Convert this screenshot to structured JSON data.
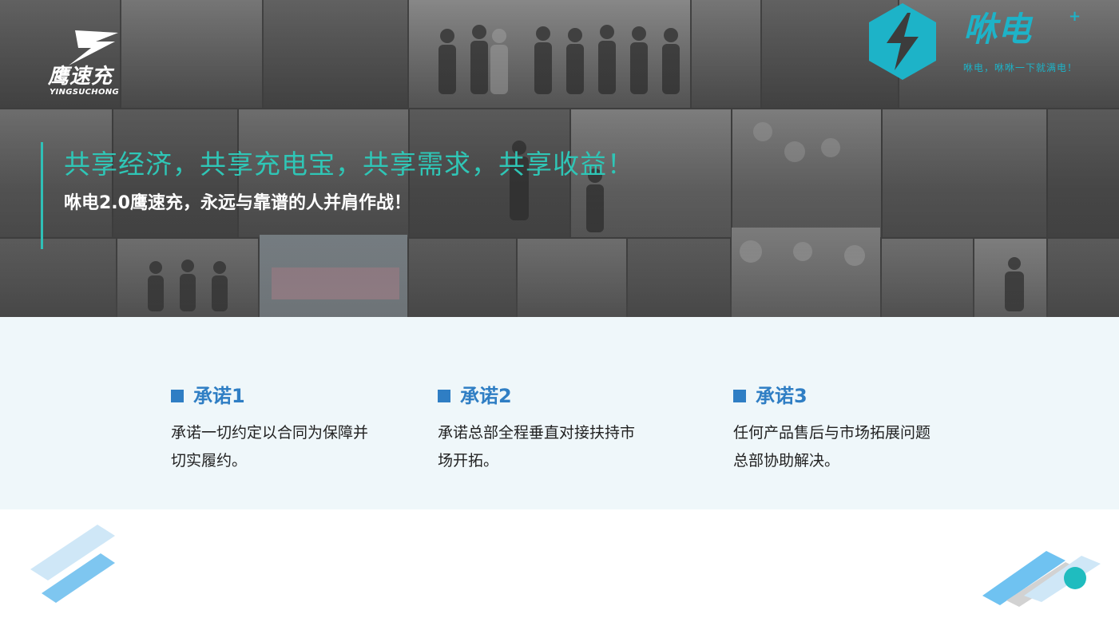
{
  "hero": {
    "brand_left": {
      "name": "鹰速充",
      "pinyin": "YINGSUCHONG"
    },
    "brand_right": {
      "name": "咻电",
      "plus": "+",
      "tagline": "咻电，咻咻一下就满电！"
    },
    "title": "共享经济，共享充电宝，共享需求，共享收益！",
    "subtitle": "咻电2.0鹰速充，永远与靠谱的人并肩作战！"
  },
  "promises": [
    {
      "title": "承诺1",
      "description": "承诺一切约定以合同为保障并切实履约。"
    },
    {
      "title": "承诺2",
      "description": "承诺总部全程垂直对接扶持市场开拓。"
    },
    {
      "title": "承诺3",
      "description": "任何产品售后与市场拓展问题总部协助解决。"
    }
  ],
  "colors": {
    "accent_teal": "#2fc6b6",
    "brand_cyan": "#1db3c8",
    "promise_blue": "#2f7ec4",
    "band_bg": "#eff7fa"
  }
}
